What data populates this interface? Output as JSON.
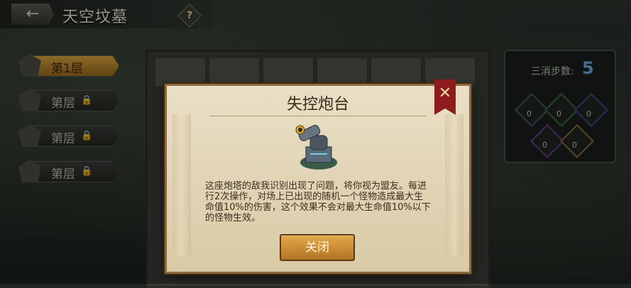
{
  "header": {
    "back_label": "←",
    "title": "天空坟墓",
    "help_label": "?"
  },
  "floors": [
    {
      "label": "第1层",
      "locked": false
    },
    {
      "label": "第层",
      "locked": true
    },
    {
      "label": "第层",
      "locked": true
    },
    {
      "label": "第层",
      "locked": true
    }
  ],
  "side_panel": {
    "steps_label": "三消步数:",
    "steps_value": "5",
    "gem_counts": [
      "0",
      "0",
      "0",
      "0",
      "0"
    ]
  },
  "dialog": {
    "title": "失控炮台",
    "description": "这座炮塔的敌我识别出现了问题，将你视为盟友。每进行2次操作，对场上已出现的随机一个怪物造成最大生命值10%的伤害，这个效果不会对最大生命值10%以下的怪物生效。",
    "close_label": "关闭",
    "x_label": "✕"
  }
}
